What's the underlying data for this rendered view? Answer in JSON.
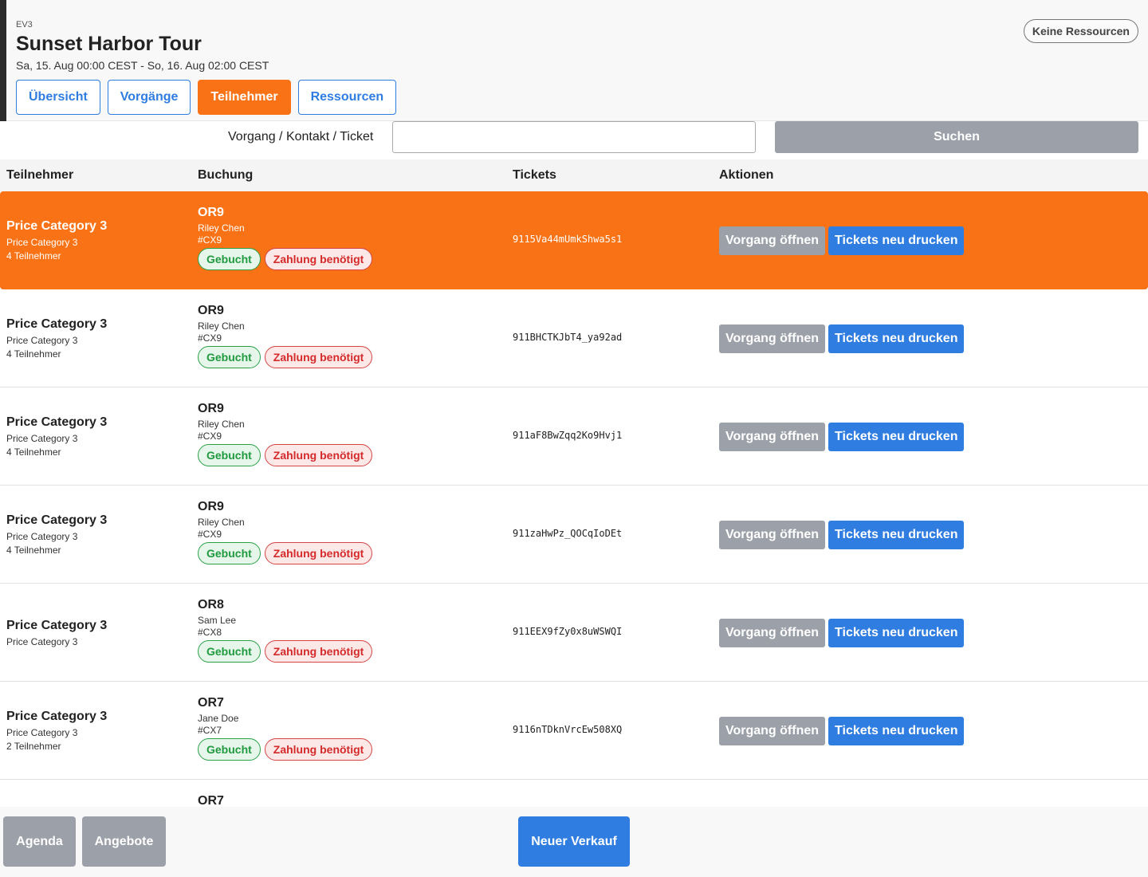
{
  "event": {
    "code": "EV3",
    "title": "Sunset Harbor Tour",
    "date": "Sa, 15. Aug 00:00 CEST - So, 16. Aug 02:00 CEST",
    "resources_badge": "Keine Ressourcen"
  },
  "tabs": [
    {
      "label": "Übersicht",
      "active": false
    },
    {
      "label": "Vorgänge",
      "active": false
    },
    {
      "label": "Teilnehmer",
      "active": true
    },
    {
      "label": "Ressourcen",
      "active": false
    }
  ],
  "search": {
    "label": "Vorgang / Kontakt / Ticket",
    "value": "",
    "placeholder": "",
    "button_label": "Suchen"
  },
  "table": {
    "headers": [
      "Teilnehmer",
      "Buchung",
      "Tickets",
      "Aktionen"
    ],
    "rows": [
      {
        "participant": "Price Category 3",
        "category": "Price Category 3",
        "count": "4 Teilnehmer",
        "order": "OR9",
        "customer": "Riley Chen",
        "number": "#CX9",
        "status": "Gebucht",
        "payment": "Zahlung benötigt",
        "ticket": "9115Va44mUmkShwa5s1",
        "selected": true
      },
      {
        "participant": "Price Category 3",
        "category": "Price Category 3",
        "count": "4 Teilnehmer",
        "order": "OR9",
        "customer": "Riley Chen",
        "number": "#CX9",
        "status": "Gebucht",
        "payment": "Zahlung benötigt",
        "ticket": "911BHCTKJbT4_ya92ad",
        "selected": false
      },
      {
        "participant": "Price Category 3",
        "category": "Price Category 3",
        "count": "4 Teilnehmer",
        "order": "OR9",
        "customer": "Riley Chen",
        "number": "#CX9",
        "status": "Gebucht",
        "payment": "Zahlung benötigt",
        "ticket": "911aF8BwZqq2Ko9Hvj1",
        "selected": false
      },
      {
        "participant": "Price Category 3",
        "category": "Price Category 3",
        "count": "4 Teilnehmer",
        "order": "OR9",
        "customer": "Riley Chen",
        "number": "#CX9",
        "status": "Gebucht",
        "payment": "Zahlung benötigt",
        "ticket": "911zaHwPz_QOCqIoDEt",
        "selected": false
      },
      {
        "participant": "Price Category 3",
        "category": "Price Category 3",
        "count": "",
        "order": "OR8",
        "customer": "Sam Lee",
        "number": "#CX8",
        "status": "Gebucht",
        "payment": "Zahlung benötigt",
        "ticket": "911EEX9fZy0x8uWSWQI",
        "selected": false
      },
      {
        "participant": "Price Category 3",
        "category": "Price Category 3",
        "count": "2 Teilnehmer",
        "order": "OR7",
        "customer": "Jane Doe",
        "number": "#CX7",
        "status": "Gebucht",
        "payment": "Zahlung benötigt",
        "ticket": "9116nTDknVrcEw508XQ",
        "selected": false
      },
      {
        "participant": "",
        "category": "",
        "count": "",
        "order": "OR7",
        "customer": "",
        "number": "",
        "status": "",
        "payment": "",
        "ticket": "",
        "selected": false,
        "partial": true
      }
    ],
    "action_open": "Vorgang öffnen",
    "action_print": "Tickets neu drucken"
  },
  "footer": {
    "agenda": "Agenda",
    "offers": "Angebote",
    "new_sale": "Neuer Verkauf"
  },
  "colors": {
    "accent_orange": "#f97316",
    "primary_blue": "#2f7de1",
    "button_grey": "#9ca0a8",
    "success_green": "#1f9a3f",
    "danger_red": "#d42a2a"
  }
}
